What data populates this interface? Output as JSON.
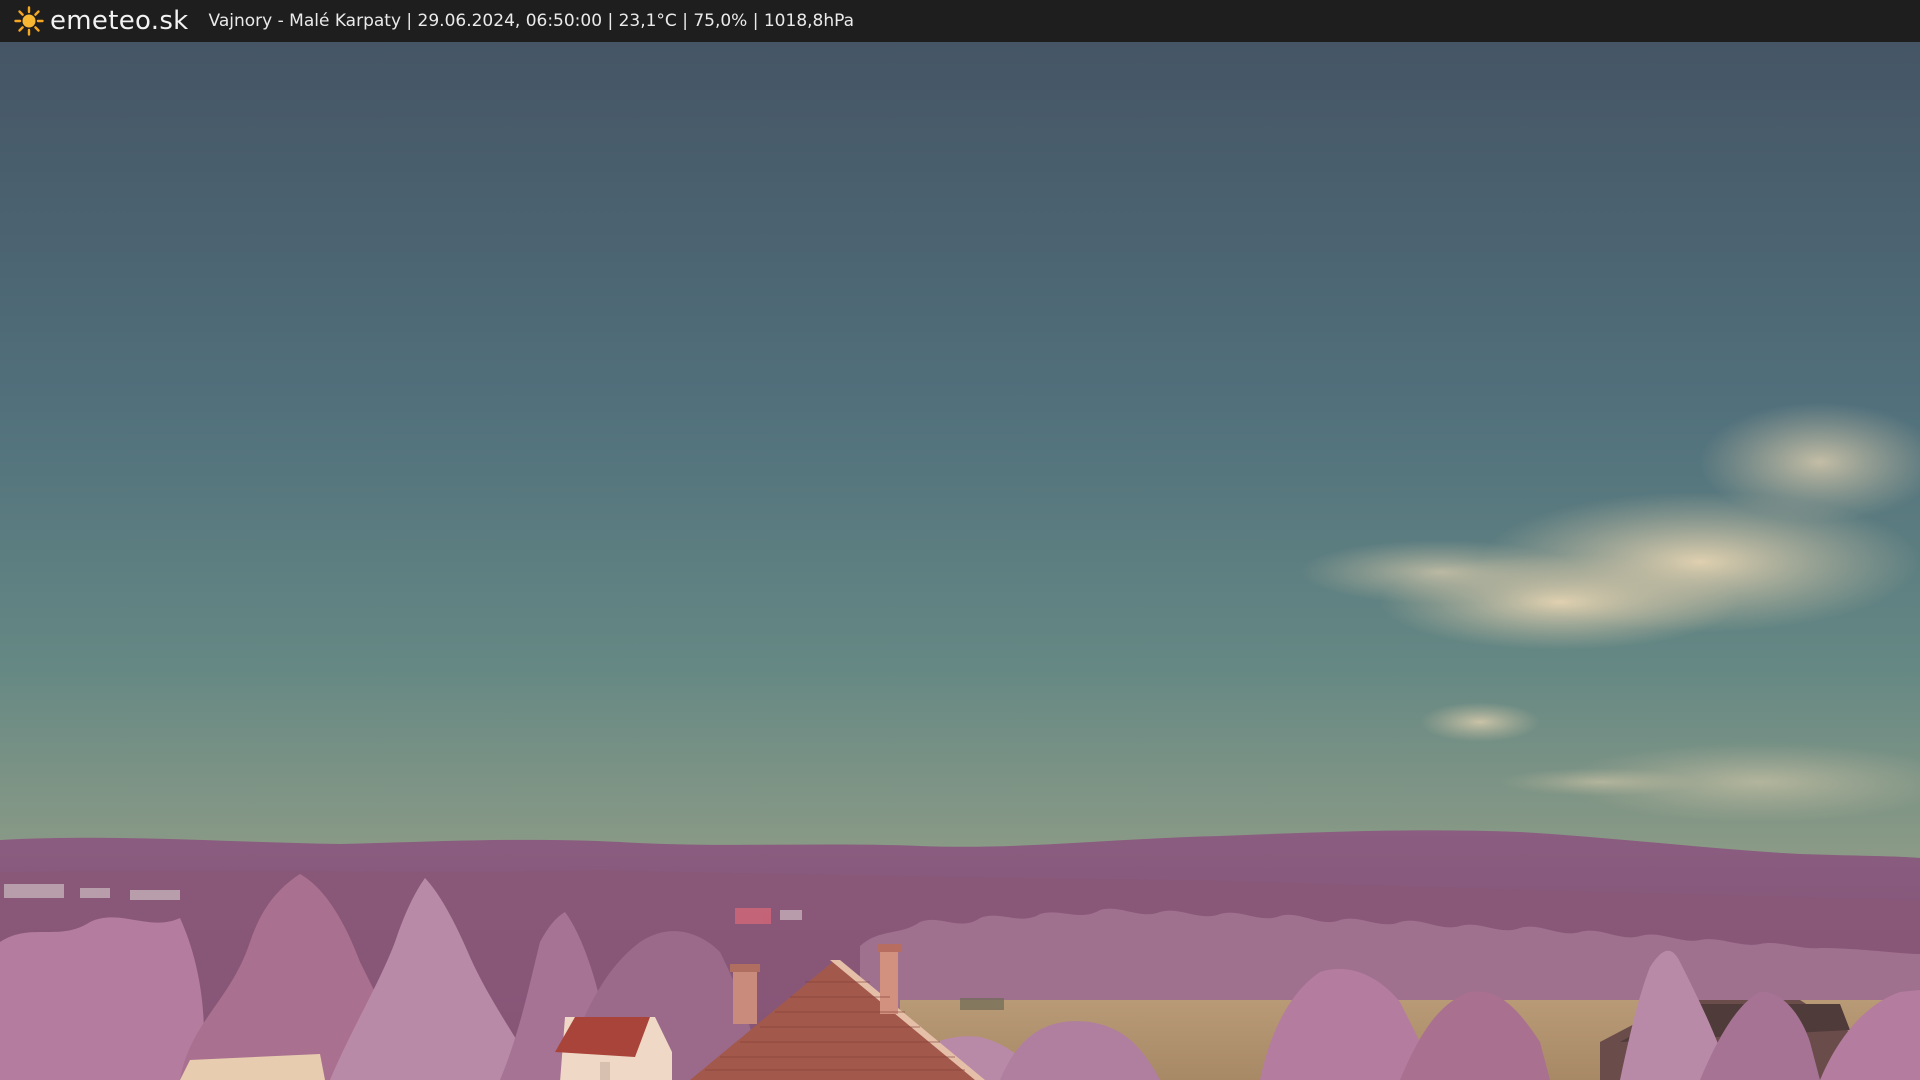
{
  "header": {
    "brand": "emeteo.sk",
    "caption": "Vajnory - Malé Karpaty | 29.06.2024, 06:50:00 | 23,1°C | 75,0% | 1018,8hPa",
    "logo_icon": "sun-icon"
  },
  "colors": {
    "bar": "#1e1e1e",
    "sun": "#f5a623",
    "sky_top": "#465868",
    "sky_mid": "#5a7a80",
    "sky_horizon": "#9b9a84",
    "hills": "#8a5a7e",
    "foliage": "#b07a9e",
    "roof": "#a24a3e",
    "field": "#b89a78"
  }
}
